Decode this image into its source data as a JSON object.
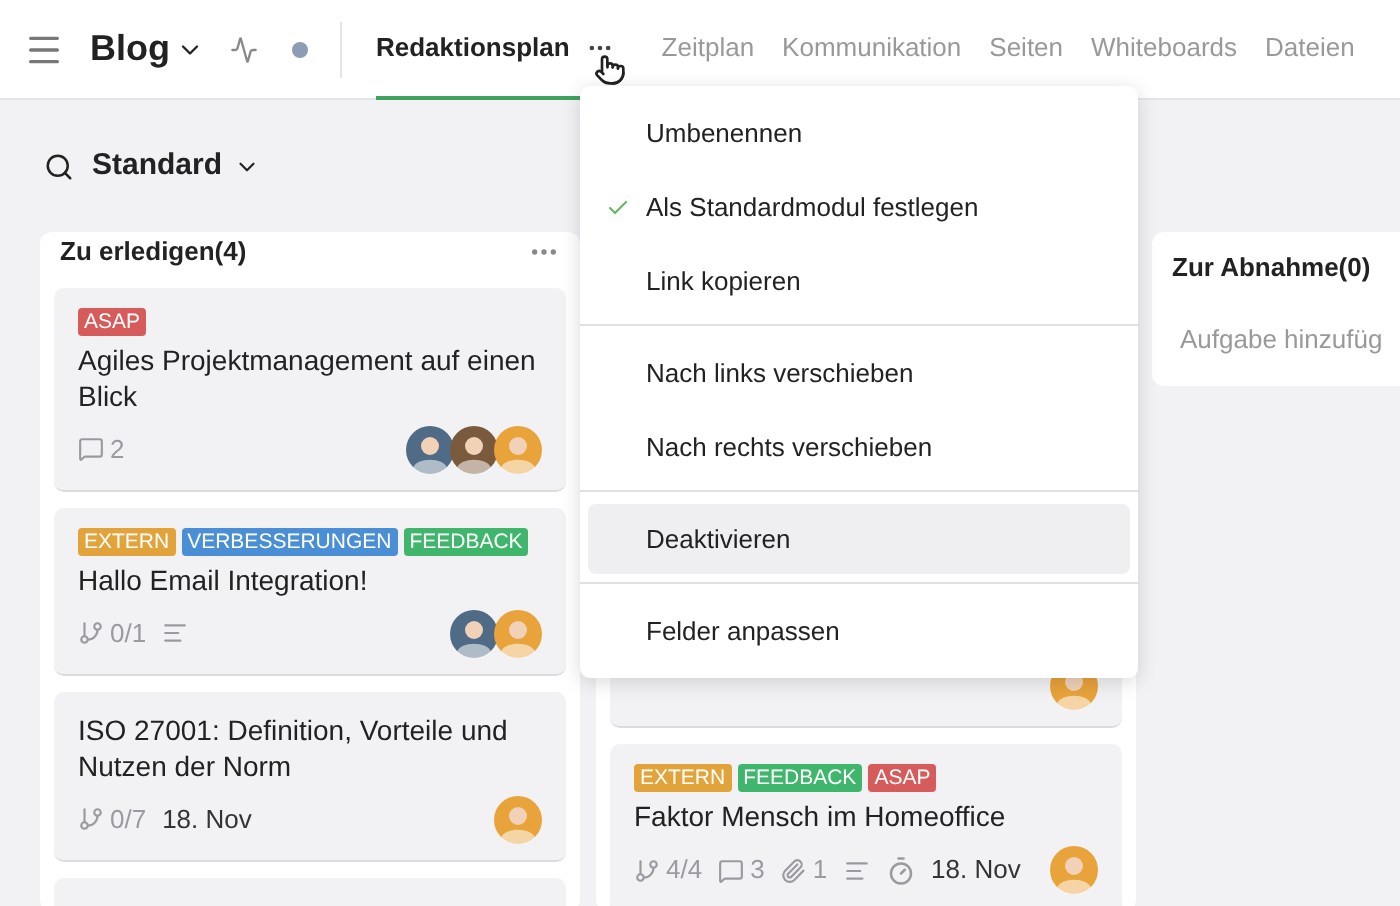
{
  "header": {
    "title": "Blog",
    "status_dot": {
      "color": "#8e9bb5"
    },
    "tabs": [
      {
        "label": "Redaktionsplan",
        "selected": true
      },
      {
        "label": "Zeitplan",
        "selected": false
      },
      {
        "label": "Kommunikation",
        "selected": false
      },
      {
        "label": "Seiten",
        "selected": false
      },
      {
        "label": "Whiteboards",
        "selected": false
      },
      {
        "label": "Dateien",
        "selected": false
      }
    ]
  },
  "view": {
    "title": "Standard"
  },
  "columns": [
    {
      "title": "Zu erledigen(4)",
      "cards": [
        {
          "kind": "task",
          "labels": [
            {
              "text": "ASAP",
              "color": "#d65c5c"
            }
          ],
          "title": "Agiles Projektmanagement auf einen Blick",
          "meta": [
            {
              "kind": "comments",
              "text": "2"
            }
          ],
          "avatars": [
            {
              "color": "#4f6b86"
            },
            {
              "color": "#7a5a3c"
            },
            {
              "color": "#e8a33a"
            }
          ]
        },
        {
          "kind": "task",
          "labels": [
            {
              "text": "EXTERN",
              "color": "#e3a33b"
            },
            {
              "text": "VERBESSERUNGEN",
              "color": "#4a8fd6"
            },
            {
              "text": "FEEDBACK",
              "color": "#3fb66b"
            }
          ],
          "title": "Hallo Email Integration!",
          "meta": [
            {
              "kind": "subtasks",
              "text": "0/1"
            },
            {
              "kind": "description"
            }
          ],
          "avatars": [
            {
              "color": "#4f6b86"
            },
            {
              "color": "#e8a33a"
            }
          ]
        },
        {
          "kind": "task",
          "title": "ISO 27001: Definition, Vorteile und Nutzen der Norm",
          "meta": [
            {
              "kind": "subtasks",
              "text": "0/7"
            },
            {
              "kind": "date",
              "text": "18. Nov"
            }
          ],
          "avatars": [
            {
              "color": "#e8a33a"
            }
          ]
        },
        {
          "kind": "partial"
        }
      ]
    },
    {
      "cards": [
        {
          "kind": "partial",
          "avatars": [
            {
              "color": "#e8a33a"
            }
          ]
        },
        {
          "kind": "task",
          "labels": [
            {
              "text": "EXTERN",
              "color": "#e3a33b"
            },
            {
              "text": "FEEDBACK",
              "color": "#3fb66b"
            },
            {
              "text": "ASAP",
              "color": "#d65c5c"
            }
          ],
          "title": "Faktor Mensch im Homeoffice",
          "meta": [
            {
              "kind": "subtasks",
              "text": "4/4"
            },
            {
              "kind": "comments",
              "text": "3"
            },
            {
              "kind": "attachments",
              "text": "1"
            },
            {
              "kind": "description"
            },
            {
              "kind": "timer"
            },
            {
              "kind": "date",
              "text": "18. Nov"
            }
          ],
          "avatars": [
            {
              "color": "#e8a33a"
            }
          ]
        }
      ]
    },
    {
      "title": "Zur Abnahme(0)",
      "add_placeholder": "Aufgabe hinzufüg"
    }
  ],
  "menu": {
    "sections": [
      [
        {
          "label": "Umbenennen",
          "checked": false,
          "highlighted": false
        },
        {
          "label": "Als Standardmodul festlegen",
          "checked": true,
          "highlighted": false
        },
        {
          "label": "Link kopieren",
          "checked": false,
          "highlighted": false
        }
      ],
      [
        {
          "label": "Nach links verschieben",
          "checked": false,
          "highlighted": false
        },
        {
          "label": "Nach rechts verschieben",
          "checked": false,
          "highlighted": false
        }
      ],
      [
        {
          "label": "Deaktivieren",
          "checked": false,
          "highlighted": true
        }
      ],
      [
        {
          "label": "Felder anpassen",
          "checked": false,
          "highlighted": false
        }
      ]
    ]
  }
}
